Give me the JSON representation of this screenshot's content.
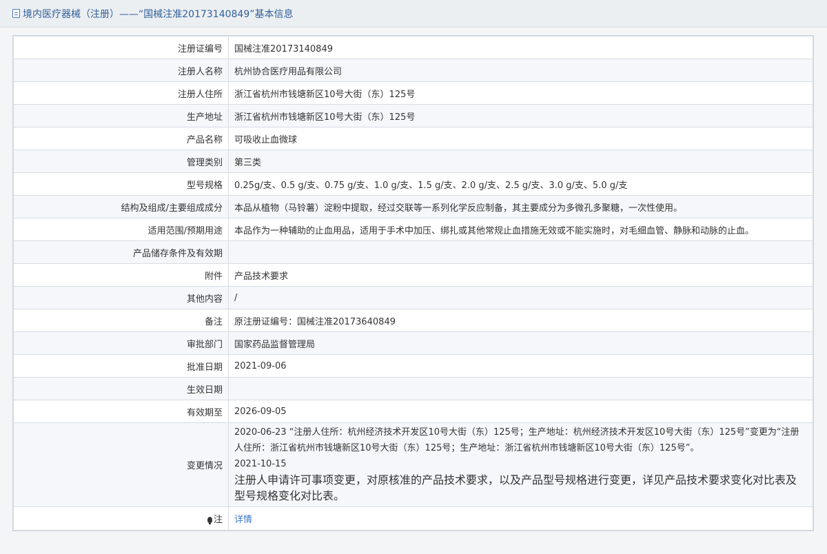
{
  "header": {
    "title": "境内医疗器械（注册）——“国械注准20173140849”基本信息"
  },
  "rows": [
    {
      "label": "注册证编号",
      "value": "国械注准20173140849"
    },
    {
      "label": "注册人名称",
      "value": "杭州协合医疗用品有限公司"
    },
    {
      "label": "注册人住所",
      "value": "浙江省杭州市钱塘新区10号大街（东）125号"
    },
    {
      "label": "生产地址",
      "value": "浙江省杭州市钱塘新区10号大街（东）125号"
    },
    {
      "label": "产品名称",
      "value": "可吸收止血微球"
    },
    {
      "label": "管理类别",
      "value": "第三类"
    },
    {
      "label": "型号规格",
      "value": "0.25g/支、0.5 g/支、0.75 g/支、1.0 g/支、1.5 g/支、2.0 g/支、2.5 g/支、3.0 g/支、5.0 g/支"
    },
    {
      "label": "结构及组成/主要组成成分",
      "value": "本品从植物（马铃薯）淀粉中提取，经过交联等一系列化学反应制备，其主要成分为多微孔多聚糖，一次性使用。"
    },
    {
      "label": "适用范围/预期用途",
      "value": "本品作为一种辅助的止血用品，适用于手术中加压、绑扎或其他常规止血措施无效或不能实施时，对毛细血管、静脉和动脉的止血。"
    },
    {
      "label": "产品储存条件及有效期",
      "value": ""
    },
    {
      "label": "附件",
      "value": "产品技术要求"
    },
    {
      "label": "其他内容",
      "value": "/"
    },
    {
      "label": "备注",
      "value": "原注册证编号：国械注准20173640849"
    },
    {
      "label": "审批部门",
      "value": "国家药品监督管理局"
    },
    {
      "label": "批准日期",
      "value": "2021-09-06"
    },
    {
      "label": "生效日期",
      "value": ""
    },
    {
      "label": "有效期至",
      "value": "2026-09-05"
    }
  ],
  "change": {
    "label": "变更情况",
    "entry1": "2020-06-23 “注册人住所：杭州经济技术开发区10号大街（东）125号；生产地址：杭州经济技术开发区10号大街（东）125号”变更为“注册人住所：浙江省杭州市钱塘新区10号大街（东）125号；生产地址：浙江省杭州市钱塘新区10号大街（东）125号”。",
    "entry2_date": "2021-10-15",
    "entry2_text": "注册人申请许可事项变更，对原核准的产品技术要求，以及产品型号规格进行变更，详见产品技术要求变化对比表及型号规格变化对比表。"
  },
  "note": {
    "label": "注",
    "icon": "lightbulb-icon",
    "link": "详情"
  },
  "colors": {
    "header_text": "#2f5f9a",
    "link": "#3a75c4",
    "row_alt": "#f5f7fa",
    "border": "#d6dce3"
  }
}
